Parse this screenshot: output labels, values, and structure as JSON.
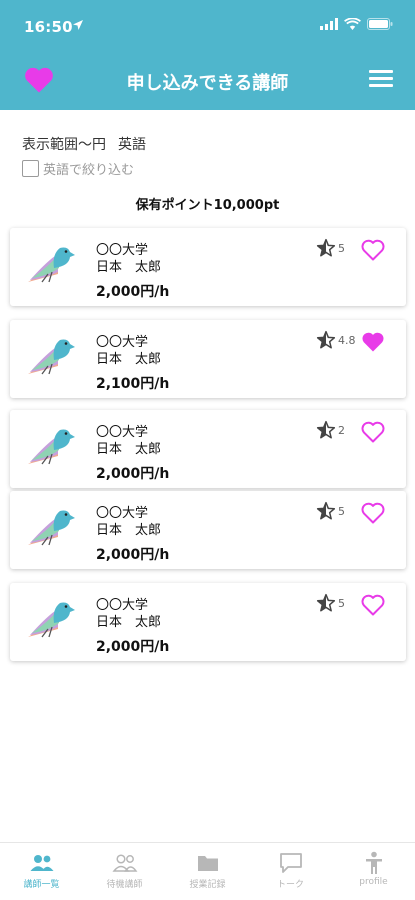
{
  "status_bar": {
    "time": "16:50"
  },
  "header": {
    "title": "申し込みできる講師"
  },
  "filter": {
    "range_text": "表示範囲〜円",
    "language": "英語",
    "checkbox_label": "英語で絞り込む",
    "checkbox_checked": false
  },
  "points": {
    "label": "保有ポイント10,000pt"
  },
  "colors": {
    "accent": "#4fb6cc",
    "favorite": "#e83be8",
    "star": "#444444"
  },
  "tutors": [
    {
      "university": "〇〇大学",
      "name": "日本　太郎",
      "price": "2,000円/h",
      "rating": "5",
      "favorite": false
    },
    {
      "university": "〇〇大学",
      "name": "日本　太郎",
      "price": "2,100円/h",
      "rating": "4.8",
      "favorite": true
    },
    {
      "university": "〇〇大学",
      "name": "日本　太郎",
      "price": "2,000円/h",
      "rating": "2",
      "favorite": false
    },
    {
      "university": "〇〇大学",
      "name": "日本　太郎",
      "price": "2,000円/h",
      "rating": "5",
      "favorite": false
    },
    {
      "university": "〇〇大学",
      "name": "日本　太郎",
      "price": "2,000円/h",
      "rating": "5",
      "favorite": false
    }
  ],
  "tabbar": {
    "tabs": [
      {
        "label": "講師一覧",
        "icon": "users-icon",
        "active": true
      },
      {
        "label": "待機講師",
        "icon": "group-icon",
        "active": false
      },
      {
        "label": "授業記録",
        "icon": "folder-icon",
        "active": false
      },
      {
        "label": "トーク",
        "icon": "chat-icon",
        "active": false
      },
      {
        "label": "profile",
        "icon": "person-icon",
        "active": false
      }
    ]
  }
}
